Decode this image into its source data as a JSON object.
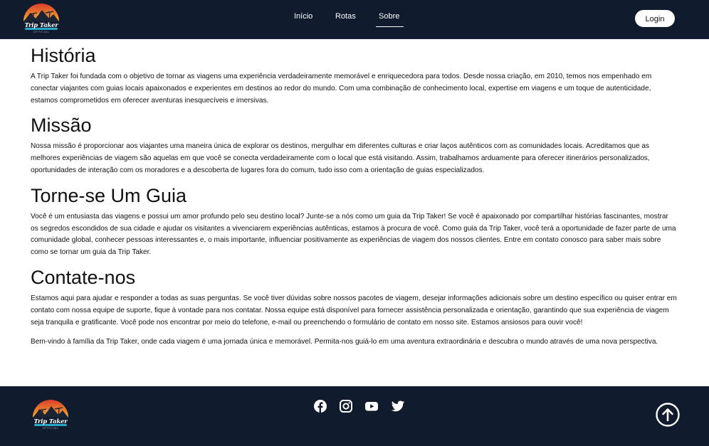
{
  "header": {
    "logo_text": "Trip Taker",
    "logo_subtext": "OFFICIAL",
    "nav": [
      {
        "label": "Início"
      },
      {
        "label": "Rotas"
      },
      {
        "label": "Sobre"
      }
    ],
    "login_label": "Login"
  },
  "sections": [
    {
      "title": "História",
      "paragraphs": [
        "A Trip Taker foi fundada com o objetivo de tornar as viagens uma experiência verdadeiramente memorável e enriquecedora para todos. Desde nossa criação, em 2010, temos nos empenhado em conectar viajantes com guias locais apaixonados e experientes em destinos ao redor do mundo. Com uma combinação de conhecimento local, expertise em viagens e um toque de autenticidade, estamos comprometidos em oferecer aventuras inesquecíveis e imersivas."
      ]
    },
    {
      "title": "Missão",
      "paragraphs": [
        "Nossa missão é proporcionar aos viajantes uma maneira única de explorar os destinos, mergulhar em diferentes culturas e criar laços autênticos com as comunidades locais. Acreditamos que as melhores experiências de viagem são aquelas em que você se conecta verdadeiramente com o local que está visitando. Assim, trabalhamos arduamente para oferecer itinerários personalizados, oportunidades de interação com os moradores e a descoberta de lugares fora do comum, tudo isso com a orientação de guias especializados."
      ]
    },
    {
      "title": "Torne-se Um Guia",
      "paragraphs": [
        "Você é um entusiasta das viagens e possui um amor profundo pelo seu destino local? Junte-se a nós como um guia da Trip Taker! Se você é apaixonado por compartilhar histórias fascinantes, mostrar os segredos escondidos de sua cidade e ajudar os visitantes a vivenciarem experiências autênticas, estamos à procura de você. Como guia da Trip Taker, você terá a oportunidade de fazer parte de uma comunidade global, conhecer pessoas interessantes e, o mais importante, influenciar positivamente as experiências de viagem dos nossos clientes. Entre em contato conosco para saber mais sobre como se tornar um guia da Trip Taker."
      ]
    },
    {
      "title": "Contate-nos",
      "paragraphs": [
        "Estamos aqui para ajudar e responder a todas as suas perguntas. Se você tiver dúvidas sobre nossos pacotes de viagem, desejar informações adicionais sobre um destino específico ou quiser entrar em contato com nossa equipe de suporte, fique à vontade para nos contatar. Nossa equipe está disponível para fornecer assistência personalizada e orientação, garantindo que sua experiência de viagem seja tranquila e gratificante. Você pode nos encontrar por meio do telefone, e-mail ou preenchendo o formulário de contato em nosso site. Estamos ansiosos para ouvir você!",
        "Bem-vindo à família da Trip Taker, onde cada viagem é uma jornada única e memorável. Permita-nos guiá-lo em uma aventura extraordinária e descubra o mundo através de uma nova perspectiva."
      ]
    }
  ],
  "footer": {
    "logo_text": "Trip Taker",
    "logo_subtext": "OFFICIAL",
    "social_icons": [
      "facebook-icon",
      "instagram-icon",
      "youtube-icon",
      "twitter-icon"
    ],
    "back_to_top_icon": "arrow-up-circle-icon"
  },
  "colors": {
    "navy": "#101b2d",
    "white": "#ffffff",
    "logo_red": "#d8402a",
    "logo_orange": "#f08a2c",
    "logo_teal": "#2aa7c8"
  }
}
